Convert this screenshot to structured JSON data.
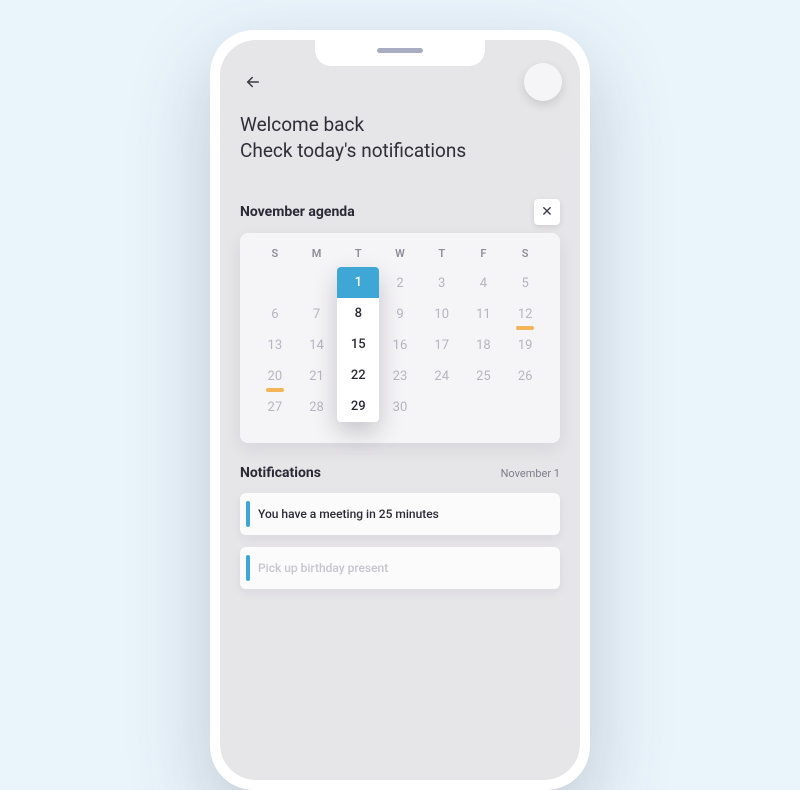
{
  "header": {
    "welcome_line1": "Welcome back",
    "welcome_line2": "Check today's notifications"
  },
  "agenda": {
    "title": "November agenda",
    "close_glyph": "✕",
    "dow": [
      "S",
      "M",
      "T",
      "W",
      "T",
      "F",
      "S"
    ],
    "weeks": [
      [
        null,
        null,
        1,
        2,
        3,
        4,
        5
      ],
      [
        6,
        7,
        8,
        9,
        10,
        11,
        12
      ],
      [
        13,
        14,
        15,
        16,
        17,
        18,
        19
      ],
      [
        20,
        21,
        22,
        23,
        24,
        25,
        26
      ],
      [
        27,
        28,
        29,
        30,
        null,
        null,
        null
      ]
    ],
    "event_days": [
      12,
      20
    ],
    "tuesday_popup": [
      1,
      8,
      15,
      22,
      29
    ],
    "selected_day": 1
  },
  "notifications": {
    "title": "Notifications",
    "date": "November 1",
    "items": [
      {
        "text": "You have a meeting in 25 minutes",
        "faded": false
      },
      {
        "text": "Pick up birthday present",
        "faded": true
      }
    ]
  }
}
